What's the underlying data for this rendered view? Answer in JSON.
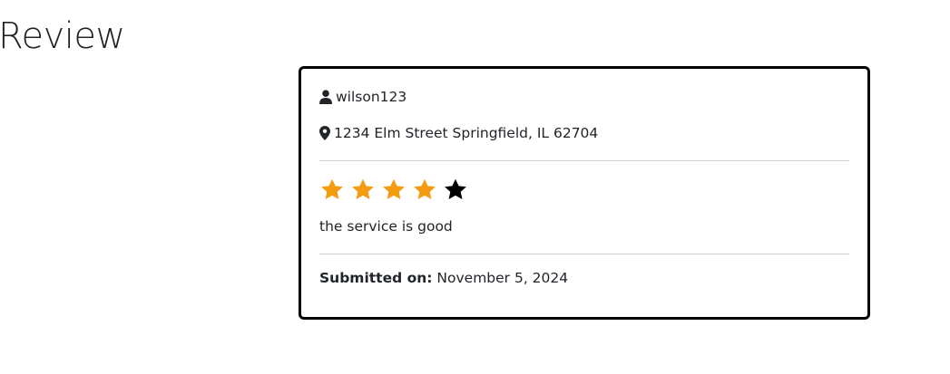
{
  "page": {
    "title": "Review"
  },
  "review": {
    "username": "wilson123",
    "address": "1234 Elm Street Springfield, IL 62704",
    "rating": 4,
    "max_rating": 5,
    "comment": "the service is good",
    "submitted_label": "Submitted on:",
    "submitted_date": "November 5, 2024"
  },
  "icons": {
    "user": "user-icon",
    "location": "map-marker-icon",
    "star": "star-icon"
  },
  "colors": {
    "star_filled": "#f39c12",
    "star_empty": "#000000",
    "card_border": "#000000"
  }
}
